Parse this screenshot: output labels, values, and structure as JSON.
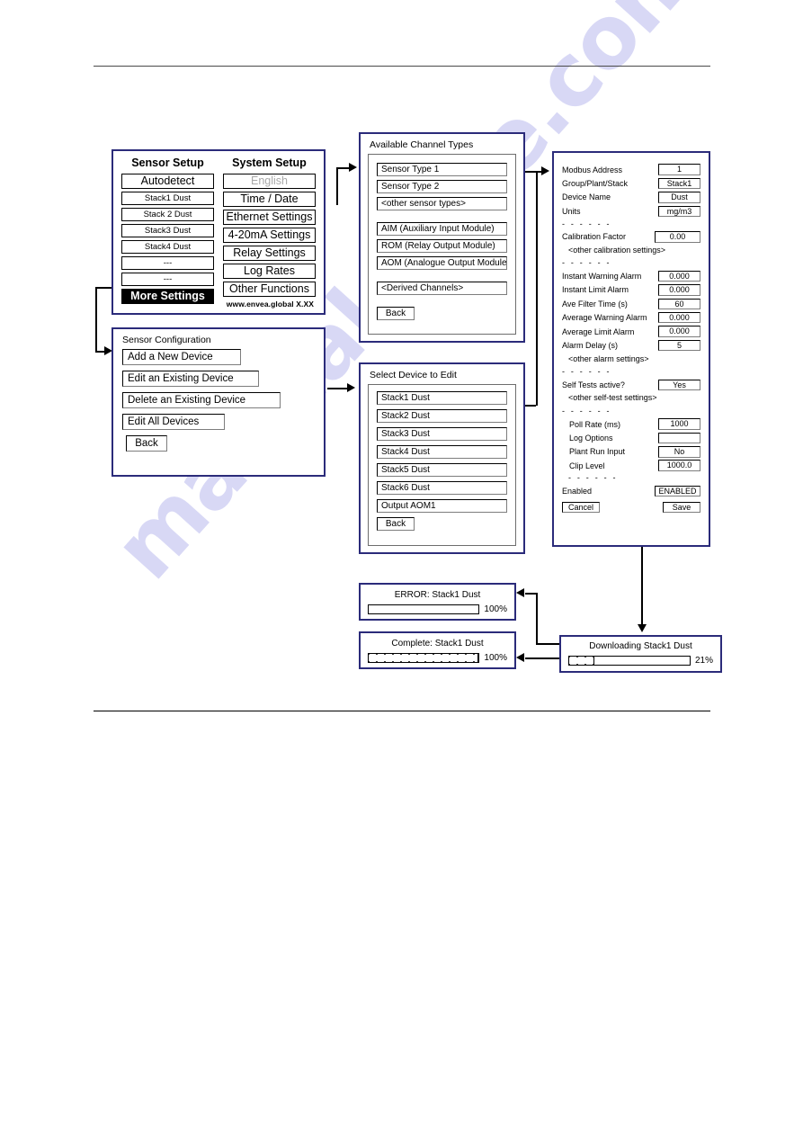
{
  "watermark": {
    "text": "manualshive.com"
  },
  "setup_screen": {
    "sensor_header": "Sensor Setup",
    "system_header": "System Setup",
    "sensor_buttons": [
      "Autodetect",
      "Stack1 Dust",
      "Stack 2 Dust",
      "Stack3 Dust",
      "Stack4 Dust",
      "---",
      "---",
      "More Settings"
    ],
    "system_buttons": [
      "English",
      "Time / Date",
      "Ethernet Settings",
      "4-20mA Settings",
      "Relay Settings",
      "Log Rates",
      "Other Functions"
    ],
    "footer": "www.envea.global  X.XX"
  },
  "sensor_configuration": {
    "title": "Sensor Configuration",
    "items": [
      "Add a New Device",
      "Edit an Existing Device",
      "Delete an Existing Device",
      "Edit All Devices",
      "Back"
    ]
  },
  "available_channel_types": {
    "title": "Available Channel Types",
    "group1": [
      "Sensor Type 1",
      "Sensor Type 2",
      "<other sensor types>"
    ],
    "group2": [
      "AIM (Auxiliary Input Module)",
      "ROM (Relay Output Module)",
      "AOM (Analogue Output Module)"
    ],
    "group3": [
      "<Derived Channels>"
    ],
    "back_label": "Back"
  },
  "select_device": {
    "title": "Select Device to Edit",
    "devices": [
      "Stack1 Dust",
      "Stack2 Dust",
      "Stack3 Dust",
      "Stack4 Dust",
      "Stack5 Dust",
      "Stack6 Dust",
      "Output AOM1"
    ],
    "back_label": "Back"
  },
  "device_settings": {
    "fields": [
      {
        "label": "Modbus Address",
        "value": "1"
      },
      {
        "label": "Group/Plant/Stack",
        "value": "Stack1"
      },
      {
        "label": "Device Name",
        "value": "Dust"
      },
      {
        "label": "Units",
        "value": "mg/m3"
      }
    ],
    "separator": "- - - - - -",
    "calibration": [
      {
        "label": "Calibration Factor",
        "value": "0.00"
      }
    ],
    "calibration_note": "<other calibration settings>",
    "alarms": [
      {
        "label": "Instant Warning Alarm",
        "value": "0.000"
      },
      {
        "label": "Instant Limit Alarm",
        "value": "0.000"
      },
      {
        "label": "Ave Filter Time (s)",
        "value": "60"
      },
      {
        "label": "Average Warning Alarm",
        "value": "0.000"
      },
      {
        "label": "Average Limit Alarm",
        "value": "0.000"
      },
      {
        "label": "Alarm Delay (s)",
        "value": "5"
      }
    ],
    "alarm_note": "<other alarm settings>",
    "self_test": [
      {
        "label": "Self Tests active?",
        "value": "Yes"
      }
    ],
    "self_test_note": "<other self-test settings>",
    "misc": [
      {
        "label": "Poll Rate (ms)",
        "value": "1000"
      },
      {
        "label": "Log Options",
        "value": ""
      },
      {
        "label": "Plant Run Input",
        "value": "No"
      },
      {
        "label": "Clip Level",
        "value": "1000.0"
      }
    ],
    "enabled": {
      "label": "Enabled",
      "value": "ENABLED"
    },
    "cancel_label": "Cancel",
    "save_label": "Save"
  },
  "dialogs": {
    "error": {
      "caption": "ERROR: Stack1 Dust",
      "percent_label": "100%",
      "percent": 0
    },
    "complete": {
      "caption": "Complete: Stack1 Dust",
      "percent_label": "100%",
      "percent": 100
    },
    "downloading": {
      "caption": "Downloading Stack1 Dust",
      "percent_label": "21%",
      "percent": 21
    }
  }
}
